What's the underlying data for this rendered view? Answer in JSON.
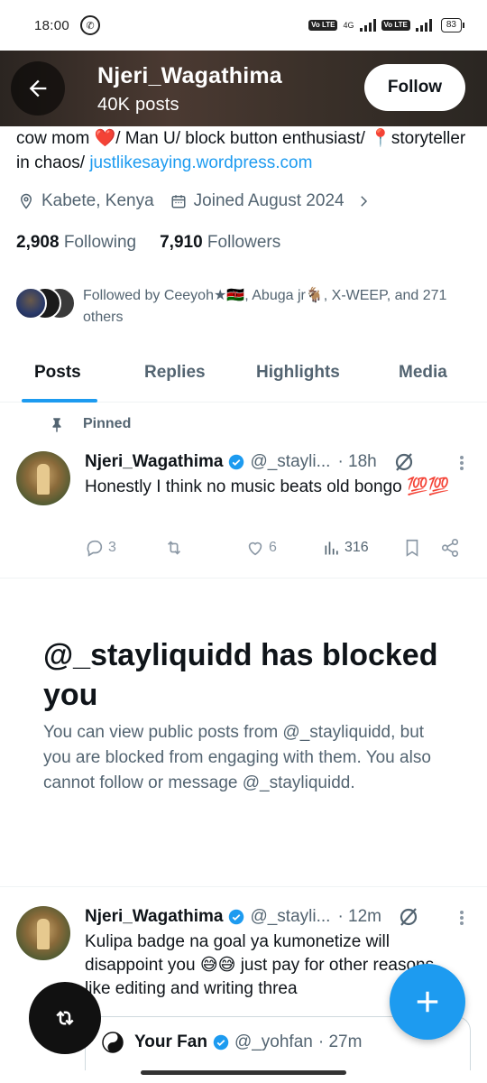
{
  "status_bar": {
    "time": "18:00",
    "battery": "83",
    "network": "4G",
    "volte1": "Vo LTE",
    "volte2": "Vo LTE"
  },
  "header": {
    "name": "Njeri_Wagathima",
    "posts": "40K posts",
    "follow_label": "Follow"
  },
  "profile": {
    "bio_text": "cow mom ❤️/ Man U/ block button enthusiast/ 📍storyteller in chaos/ ",
    "bio_link": "justlikesaying.wordpress.com",
    "location": "Kabete, Kenya",
    "joined": "Joined August 2024",
    "following_count": "2,908",
    "following_label": "Following",
    "followers_count": "7,910",
    "followers_label": "Followers",
    "followed_by": "Followed by Ceeyoh★🇰🇪, Abuga jr🐐, X-WEEP, and 271 others"
  },
  "tabs": [
    "Posts",
    "Replies",
    "Highlights",
    "Media"
  ],
  "pinned_label": "Pinned",
  "tweet1": {
    "name": "Njeri_Wagathima",
    "handle": "@_stayli...",
    "time": "· 18h",
    "text": "Honestly I think no music beats old bongo 💯💯",
    "replies": "3",
    "likes": "6",
    "views": "316"
  },
  "blocked": {
    "title": "@_stayliquidd has blocked you",
    "body": "You can view public posts from @_stayliquidd, but you are blocked from engaging with them. You also cannot follow or message @_stayliquidd."
  },
  "tweet2": {
    "name": "Njeri_Wagathima",
    "handle": "@_stayli...",
    "time": "· 12m",
    "text": "Kulipa badge na goal ya kumonetize will disappoint you 😅😅 just pay for other reasons like editing and writing threa"
  },
  "quote": {
    "name": "Your Fan",
    "handle": "@_yohfan",
    "time": "· 27m"
  },
  "colors": {
    "accent": "#1d9bf0",
    "text": "#0f1419",
    "muted": "#536471"
  },
  "icons": [
    "back-arrow-icon",
    "location-icon",
    "calendar-icon",
    "chevron-right-icon",
    "pin-icon",
    "verified-icon",
    "grok-icon",
    "more-icon",
    "reply-icon",
    "retweet-icon",
    "like-icon",
    "views-icon",
    "bookmark-icon",
    "share-icon",
    "compose-icon",
    "refresh-icon"
  ]
}
